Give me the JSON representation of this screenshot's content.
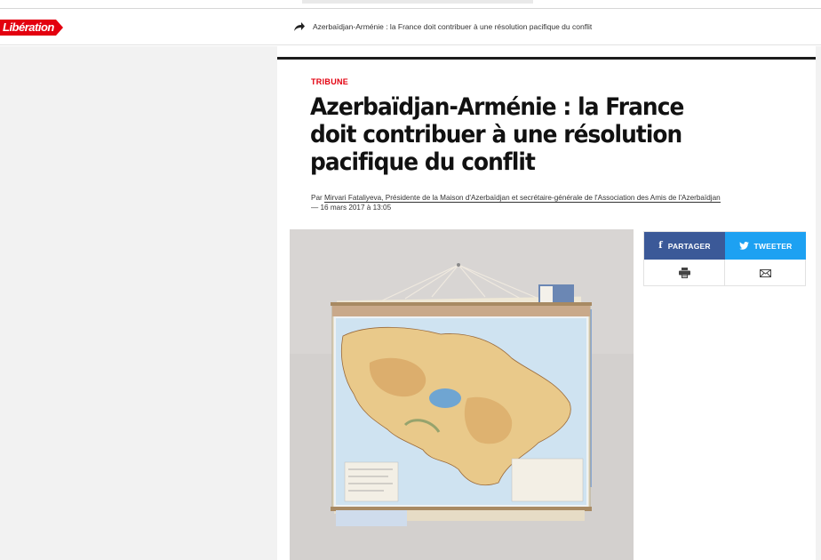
{
  "header": {
    "logo_text": "Libération",
    "article_title": "Azerbaïdjan-Arménie : la France doit contribuer à une résolution pacifique du conflit",
    "share_icon": "share-arrow-icon"
  },
  "article": {
    "rubric": "TRIBUNE",
    "title": "Azerbaïdjan-Arménie : la France doit contribuer à une résolution pacifique du conflit",
    "byline_prefix": "Par ",
    "author": "Mirvari Fataliyeva, Présidente de la Maison d'Azerbaïdjan et secrétaire-générale de l'Association des Amis de l'Azerbaïdjan",
    "date": "— 16 mars 2017 à 13:05"
  },
  "share": {
    "facebook_label": "PARTAGER",
    "twitter_label": "TWEETER",
    "facebook_icon": "facebook-icon",
    "twitter_icon": "twitter-icon",
    "print_icon": "print-icon",
    "mail_icon": "mail-icon"
  },
  "colors": {
    "brand_red": "#e3000f",
    "facebook": "#3b5998",
    "twitter": "#1da1f2"
  }
}
